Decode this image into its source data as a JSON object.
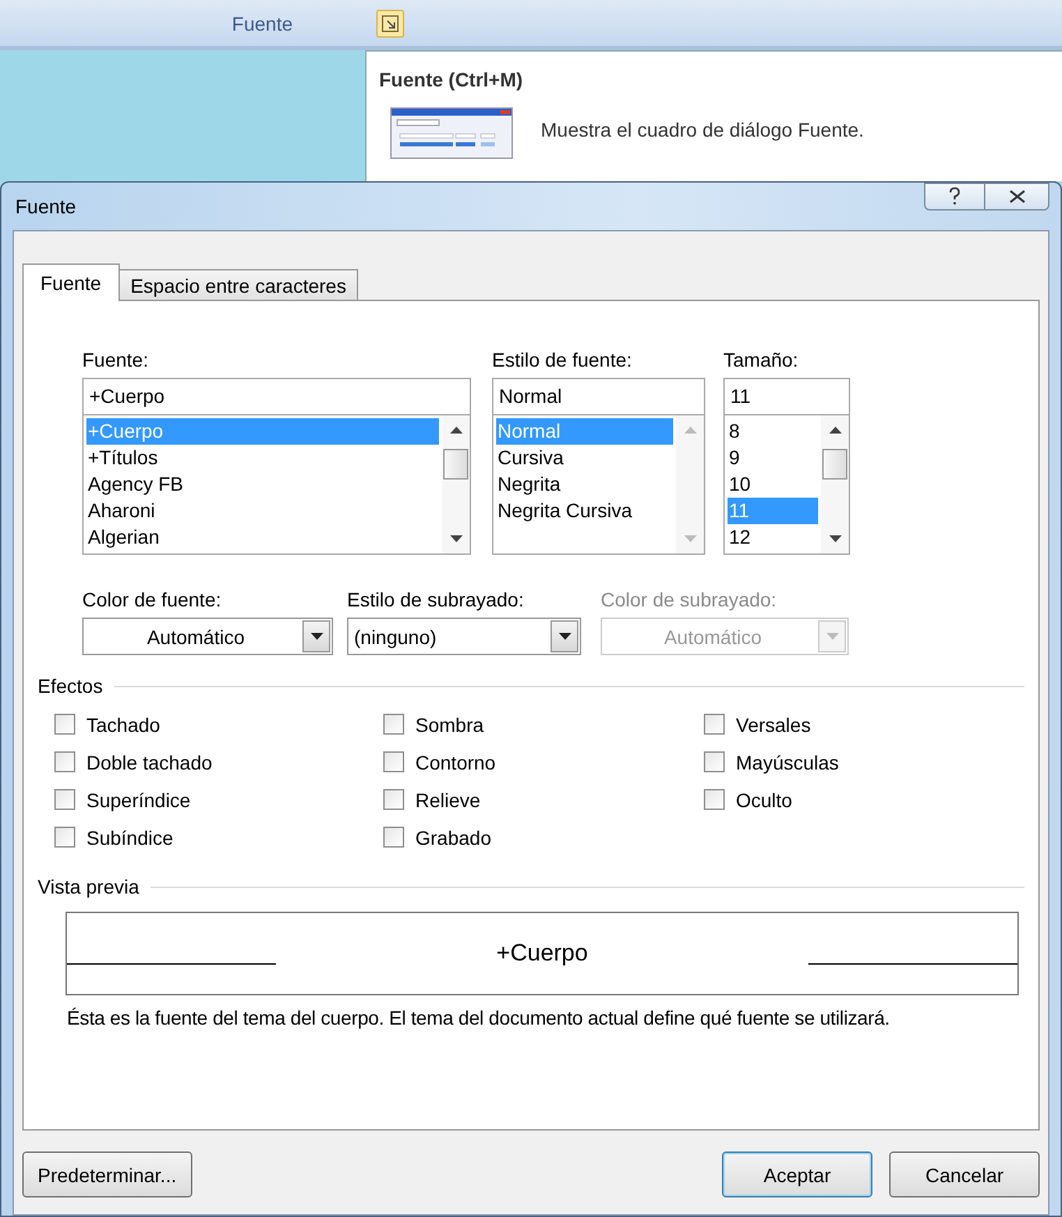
{
  "ribbon": {
    "group_label": "Fuente"
  },
  "tooltip": {
    "title": "Fuente (Ctrl+M)",
    "description": "Muestra el cuadro de diálogo Fuente."
  },
  "dialog": {
    "title": "Fuente",
    "tabs": [
      {
        "label": "Fuente",
        "selected": true
      },
      {
        "label": "Espacio entre caracteres",
        "selected": false
      }
    ],
    "font": {
      "label": "Fuente:",
      "value": "+Cuerpo",
      "items": [
        {
          "label": "+Cuerpo",
          "selected": true
        },
        {
          "label": "+Títulos",
          "selected": false
        },
        {
          "label": "Agency FB",
          "selected": false
        },
        {
          "label": "Aharoni",
          "selected": false
        },
        {
          "label": "Algerian",
          "selected": false
        }
      ]
    },
    "style": {
      "label": "Estilo de fuente:",
      "value": "Normal",
      "items": [
        {
          "label": "Normal",
          "selected": true
        },
        {
          "label": "Cursiva",
          "selected": false
        },
        {
          "label": "Negrita",
          "selected": false
        },
        {
          "label": "Negrita Cursiva",
          "selected": false
        }
      ]
    },
    "size": {
      "label": "Tamaño:",
      "value": "11",
      "items": [
        {
          "label": "8",
          "selected": false
        },
        {
          "label": "9",
          "selected": false
        },
        {
          "label": "10",
          "selected": false
        },
        {
          "label": "11",
          "selected": true
        },
        {
          "label": "12",
          "selected": false
        }
      ]
    },
    "dropdowns": [
      {
        "label": "Color de fuente:",
        "value": "Automático",
        "disabled": false,
        "centered": true
      },
      {
        "label": "Estilo de subrayado:",
        "value": "(ninguno)",
        "disabled": false,
        "centered": false
      },
      {
        "label": "Color de subrayado:",
        "value": "Automático",
        "disabled": true,
        "centered": true
      }
    ],
    "effects": {
      "title": "Efectos",
      "items": [
        {
          "label": "Tachado",
          "checked": false
        },
        {
          "label": "Doble tachado",
          "checked": false
        },
        {
          "label": "Superíndice",
          "checked": false
        },
        {
          "label": "Subíndice",
          "checked": false
        },
        {
          "label": "Sombra",
          "checked": false
        },
        {
          "label": "Contorno",
          "checked": false
        },
        {
          "label": "Relieve",
          "checked": false
        },
        {
          "label": "Grabado",
          "checked": false
        },
        {
          "label": "Versales",
          "checked": false
        },
        {
          "label": "Mayúsculas",
          "checked": false
        },
        {
          "label": "Oculto",
          "checked": false
        }
      ]
    },
    "preview": {
      "title": "Vista previa",
      "sample": "+Cuerpo",
      "note": "Ésta es la fuente del tema del cuerpo. El tema del documento actual define qué fuente se utilizará."
    },
    "buttons": [
      {
        "label": "Predeterminar...",
        "kind": "left",
        "default": false
      },
      {
        "label": "Aceptar",
        "kind": "right",
        "default": true
      },
      {
        "label": "Cancelar",
        "kind": "right",
        "default": false
      }
    ]
  }
}
